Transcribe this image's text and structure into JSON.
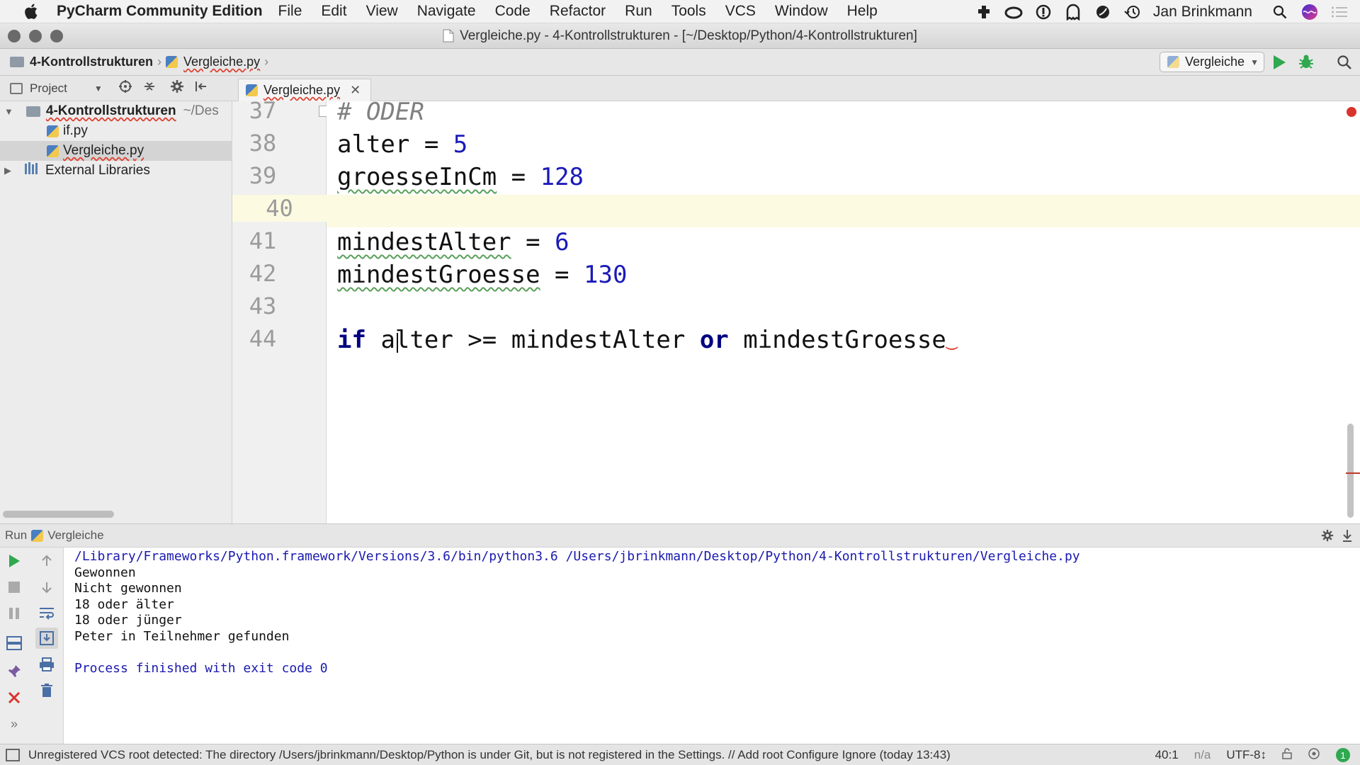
{
  "menubar": {
    "app_name": "PyCharm Community Edition",
    "items": [
      "File",
      "Edit",
      "View",
      "Navigate",
      "Code",
      "Refactor",
      "Run",
      "Tools",
      "VCS",
      "Window",
      "Help"
    ],
    "user": "Jan Brinkmann"
  },
  "window": {
    "title": "Vergleiche.py - 4-Kontrollstrukturen - [~/Desktop/Python/4-Kontrollstrukturen]"
  },
  "navbar": {
    "crumbs": [
      "4-Kontrollstrukturen",
      "Vergleiche.py"
    ],
    "run_config": "Vergleiche"
  },
  "project_panel": {
    "title": "Project"
  },
  "tree": {
    "root_name": "4-Kontrollstrukturen",
    "root_path": "~/Des",
    "files": [
      "if.py",
      "Vergleiche.py"
    ],
    "external": "External Libraries"
  },
  "editor": {
    "tab_label": "Vergleiche.py",
    "line_numbers": [
      "37",
      "38",
      "39",
      "40",
      "41",
      "42",
      "43",
      "44"
    ],
    "comment_text": "# ODER",
    "var_alter": "alter",
    "var_groesse": "groesseInCm",
    "var_mindestalter": "mindestAlter",
    "var_mindestgroesse": "mindestGroesse",
    "op_assign": " = ",
    "op_gte": " >= ",
    "val_alter": "5",
    "val_groesse": "128",
    "val_mindestalter": "6",
    "val_mindestgroesse": "130",
    "kw_if": "if",
    "kw_or": "or",
    "if_var": "alter",
    "if_rhs": "mindestAlter",
    "if_tail": "mindestGroesse"
  },
  "run_panel": {
    "label": "Run",
    "config": "Vergleiche"
  },
  "console": {
    "command": "/Library/Frameworks/Python.framework/Versions/3.6/bin/python3.6 /Users/jbrinkmann/Desktop/Python/4-Kontrollstrukturen/Vergleiche.py",
    "output": [
      "Gewonnen",
      "Nicht gewonnen",
      "18 oder älter",
      "18 oder jünger",
      "Peter in Teilnehmer gefunden",
      ""
    ],
    "finish": "Process finished with exit code 0"
  },
  "statusbar": {
    "message": "Unregistered VCS root detected: The directory /Users/jbrinkmann/Desktop/Python is under Git, but is not registered in the Settings. // Add root  Configure  Ignore (today 13:43)",
    "position": "40:1",
    "na": "n/a",
    "encoding": "UTF-8↕",
    "badge": "1"
  },
  "colors": {
    "keyword": "#000080",
    "number": "#1b1bb8",
    "run_green": "#2fa84f",
    "stop_red": "#d9342b"
  }
}
